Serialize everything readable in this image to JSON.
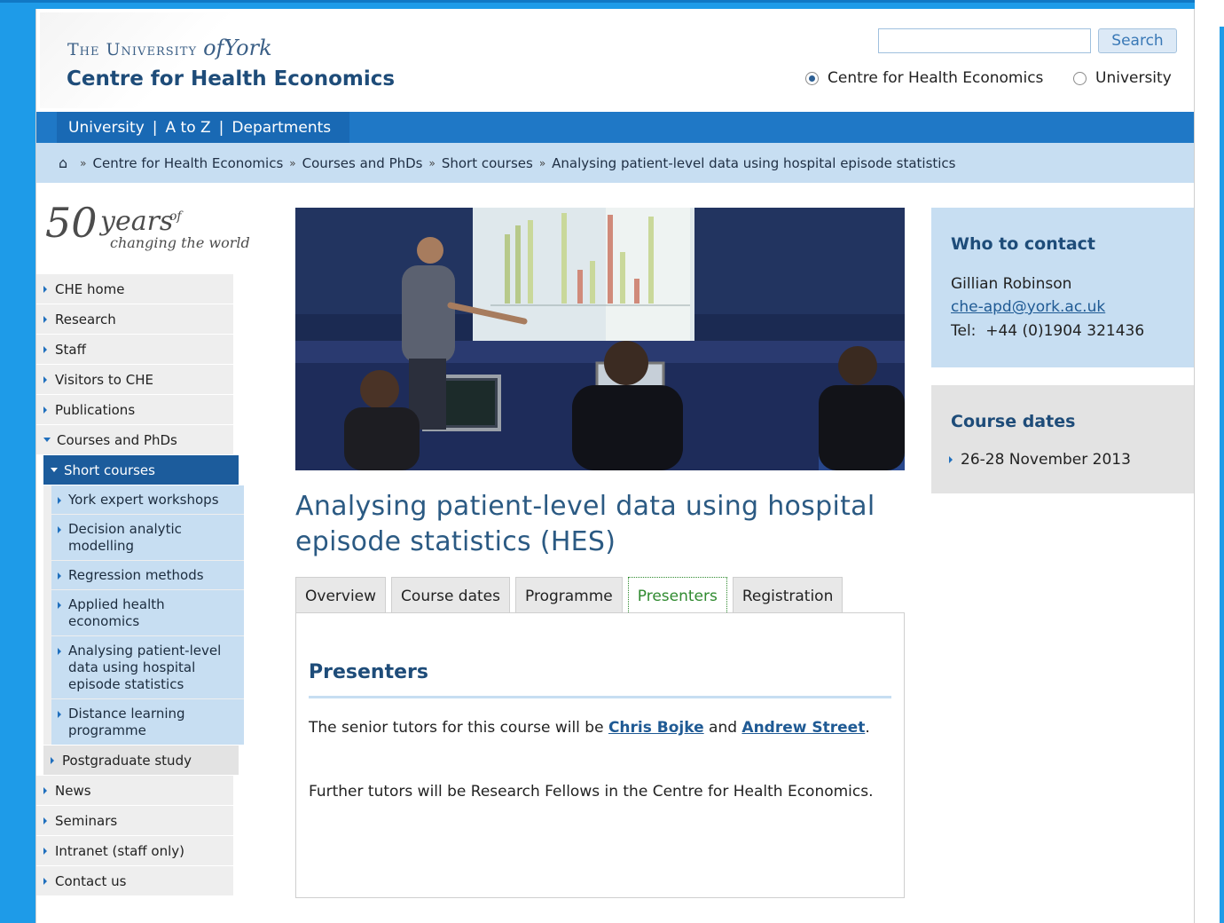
{
  "header": {
    "university_prefix": "The University",
    "university_of": "of",
    "university_york": "York",
    "site_name": "Centre for Health Economics",
    "search_button": "Search",
    "search_placeholder": "",
    "search_value": "",
    "radio_che": "Centre for Health Economics",
    "radio_university": "University",
    "radio_selected": "Centre for Health Economics"
  },
  "navbar": {
    "items": [
      "University",
      "A to Z",
      "Departments"
    ],
    "separator": "|"
  },
  "breadcrumb": {
    "home_icon": "home-icon",
    "items": [
      "Centre for Health Economics",
      "Courses and PhDs",
      "Short courses",
      "Analysing patient-level data using hospital episode statistics"
    ]
  },
  "logo50": {
    "number": "50",
    "years": "years",
    "of": "of",
    "tagline": "changing the world"
  },
  "leftnav": {
    "items": [
      "CHE home",
      "Research",
      "Staff",
      "Visitors to CHE",
      "Publications",
      "Courses and PhDs"
    ],
    "active": "Short courses",
    "sub_items": [
      "York expert workshops",
      "Decision analytic modelling",
      "Regression methods",
      "Applied health economics",
      "Analysing patient-level data using hospital episode statistics",
      "Distance learning programme"
    ],
    "postgraduate": "Postgraduate study",
    "after": [
      "News",
      "Seminars",
      "Intranet (staff only)",
      "Contact us"
    ]
  },
  "main": {
    "title": "Analysing patient-level data using hospital episode statistics (HES)",
    "tabs": [
      "Overview",
      "Course dates",
      "Programme",
      "Presenters",
      "Registration"
    ],
    "active_tab": "Presenters",
    "panel": {
      "heading": "Presenters",
      "p1_before": "The senior tutors for this course will be ",
      "link1": "Chris Bojke",
      "p1_and": " and ",
      "link2": "Andrew Street",
      "p1_after": ".",
      "p2": "Further tutors will be Research Fellows in the Centre for Health Economics."
    }
  },
  "sidebar": {
    "contact": {
      "title": "Who to contact",
      "name": "Gillian Robinson",
      "email": "che-apd@york.ac.uk",
      "tel_label": "Tel:",
      "tel": "+44 (0)1904 321436"
    },
    "dates": {
      "title": "Course dates",
      "items": [
        "26-28 November 2013"
      ]
    }
  },
  "colors": {
    "brand_blue": "#1f78c6",
    "dark_blue": "#1e4c79",
    "light_blue": "#c7def2",
    "active_tab_green": "#2f8a2f"
  }
}
